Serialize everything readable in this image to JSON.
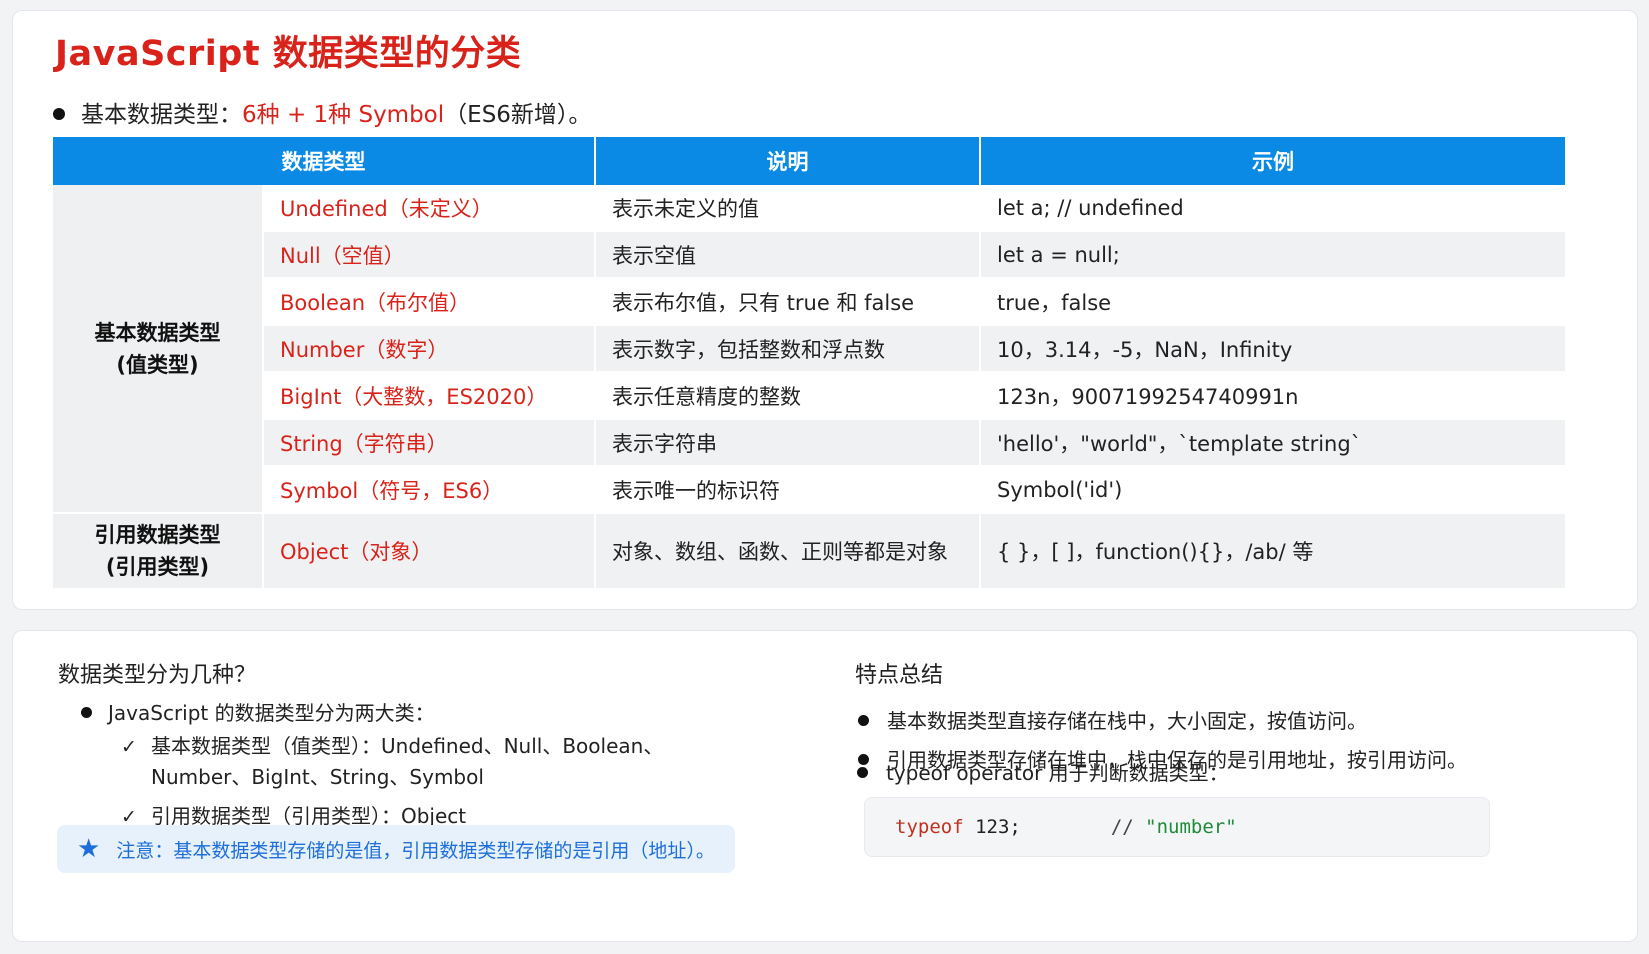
{
  "title": "JavaScript 数据类型的分类",
  "intro": {
    "prefix": "基本数据类型：",
    "highlight": "6种 + 1种 Symbol",
    "suffix": "（ES6新增）。"
  },
  "table": {
    "headers": [
      "数据类型",
      "说明",
      "示例"
    ],
    "primitive_group": [
      "基本数据类型",
      "(值类型)"
    ],
    "reference_group": [
      "引用数据类型",
      "(引用类型)"
    ],
    "primitive_rows": [
      {
        "type": "Undefined（未定义）",
        "desc": "表示未定义的值",
        "example": "let a; // undefined"
      },
      {
        "type": "Null（空值）",
        "desc": "表示空值",
        "example": "let a = null;"
      },
      {
        "type": "Boolean（布尔值）",
        "desc": "表示布尔值，只有 true 和 false",
        "example": "true，false"
      },
      {
        "type": "Number（数字）",
        "desc": "表示数字，包括整数和浮点数",
        "example": "10，3.14，-5，NaN，Infinity"
      },
      {
        "type": "BigInt（大整数，ES2020）",
        "desc": "表示任意精度的整数",
        "example": "123n，9007199254740991n"
      },
      {
        "type": "String（字符串）",
        "desc": "表示字符串",
        "example": "'hello'，\"world\"，`template string`"
      },
      {
        "type": "Symbol（符号，ES6）",
        "desc": "表示唯一的标识符",
        "example": "Symbol('id')"
      }
    ],
    "reference_row": {
      "type": "Object（对象）",
      "desc": "对象、数组、函数、正则等都是对象",
      "example": "{ }，[ ]，function(){}，/ab/ 等"
    }
  },
  "left_panel": {
    "question": "数据类型分为几种？",
    "category_line": "JavaScript 的数据类型分为两大类：",
    "checks": [
      {
        "line1": "基本数据类型（值类型）：Undefined、Null、Boolean、",
        "line2": "Number、BigInt、String、Symbol"
      },
      {
        "line1": "引用数据类型（引用类型）：Object",
        "line2": ""
      }
    ],
    "check_mark": "✓",
    "note": "注意：基本数据类型存储的是值，引用数据类型存储的是引用（地址）。"
  },
  "right_panel": {
    "title": "特点总结",
    "points": [
      "基本数据类型直接存储在栈中，大小固定，按值访问。",
      "引用数据类型存储在堆中，栈中保存的是引用地址，按引用访问。",
      "typeof operator 用于判断数据类型："
    ],
    "code": {
      "keyword": "typeof",
      "value": " 123;",
      "comment": "// ",
      "string": "\"number\""
    }
  },
  "colors": {
    "accent_red": "#d9231a",
    "header_blue": "#0a8ae5",
    "note_blue": "#1e6fd9"
  },
  "icons": [
    "star-icon",
    "check-icon",
    "bullet-dot-icon"
  ]
}
